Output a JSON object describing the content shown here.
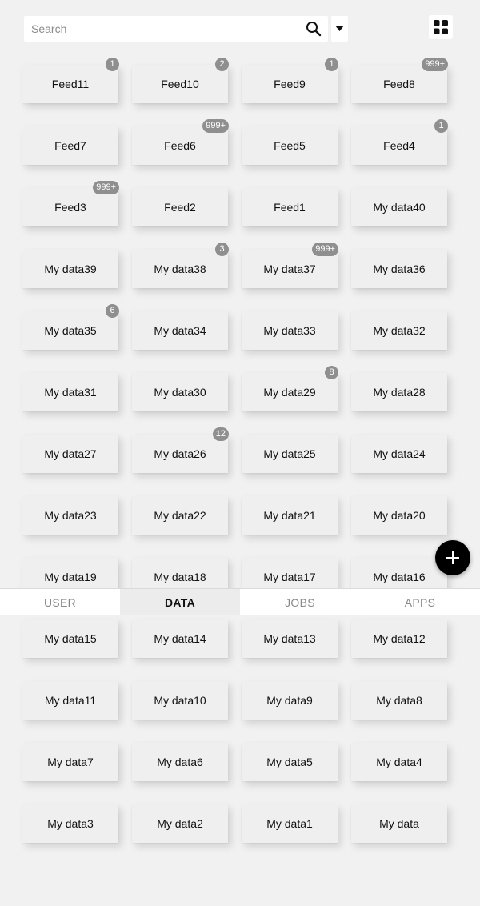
{
  "search": {
    "placeholder": "Search",
    "value": ""
  },
  "icons": {
    "search": "search-icon",
    "dropdown": "caret-down-icon",
    "view": "grid-view-icon",
    "fab": "plus-icon"
  },
  "tiles": [
    {
      "label": "Feed11",
      "badge": "1"
    },
    {
      "label": "Feed10",
      "badge": "2"
    },
    {
      "label": "Feed9",
      "badge": "1"
    },
    {
      "label": "Feed8",
      "badge": "999+"
    },
    {
      "label": "Feed7",
      "badge": ""
    },
    {
      "label": "Feed6",
      "badge": "999+"
    },
    {
      "label": "Feed5",
      "badge": ""
    },
    {
      "label": "Feed4",
      "badge": "1"
    },
    {
      "label": "Feed3",
      "badge": "999+"
    },
    {
      "label": "Feed2",
      "badge": ""
    },
    {
      "label": "Feed1",
      "badge": ""
    },
    {
      "label": "My data40",
      "badge": ""
    },
    {
      "label": "My data39",
      "badge": ""
    },
    {
      "label": "My data38",
      "badge": "3"
    },
    {
      "label": "My data37",
      "badge": "999+"
    },
    {
      "label": "My data36",
      "badge": ""
    },
    {
      "label": "My data35",
      "badge": "6"
    },
    {
      "label": "My data34",
      "badge": ""
    },
    {
      "label": "My data33",
      "badge": ""
    },
    {
      "label": "My data32",
      "badge": ""
    },
    {
      "label": "My data31",
      "badge": ""
    },
    {
      "label": "My data30",
      "badge": ""
    },
    {
      "label": "My data29",
      "badge": "8"
    },
    {
      "label": "My data28",
      "badge": ""
    },
    {
      "label": "My data27",
      "badge": ""
    },
    {
      "label": "My data26",
      "badge": "12"
    },
    {
      "label": "My data25",
      "badge": ""
    },
    {
      "label": "My data24",
      "badge": ""
    },
    {
      "label": "My data23",
      "badge": ""
    },
    {
      "label": "My data22",
      "badge": ""
    },
    {
      "label": "My data21",
      "badge": ""
    },
    {
      "label": "My data20",
      "badge": ""
    },
    {
      "label": "My data19",
      "badge": ""
    },
    {
      "label": "My data18",
      "badge": ""
    },
    {
      "label": "My data17",
      "badge": ""
    },
    {
      "label": "My data16",
      "badge": ""
    },
    {
      "label": "My data15",
      "badge": ""
    },
    {
      "label": "My data14",
      "badge": ""
    },
    {
      "label": "My data13",
      "badge": ""
    },
    {
      "label": "My data12",
      "badge": ""
    },
    {
      "label": "My data11",
      "badge": ""
    },
    {
      "label": "My data10",
      "badge": ""
    },
    {
      "label": "My data9",
      "badge": ""
    },
    {
      "label": "My data8",
      "badge": ""
    },
    {
      "label": "My data7",
      "badge": ""
    },
    {
      "label": "My data6",
      "badge": ""
    },
    {
      "label": "My data5",
      "badge": ""
    },
    {
      "label": "My data4",
      "badge": ""
    },
    {
      "label": "My data3",
      "badge": ""
    },
    {
      "label": "My data2",
      "badge": ""
    },
    {
      "label": "My data1",
      "badge": ""
    },
    {
      "label": "My data",
      "badge": ""
    }
  ],
  "tabs": [
    {
      "label": "USER",
      "active": false
    },
    {
      "label": "DATA",
      "active": true
    },
    {
      "label": "JOBS",
      "active": false
    },
    {
      "label": "APPS",
      "active": false
    }
  ],
  "colors": {
    "background": "#f1f1f1",
    "tile": "#efefef",
    "badge": "#8f8f8f",
    "fab": "#000000",
    "active_tab": "#ececec"
  }
}
